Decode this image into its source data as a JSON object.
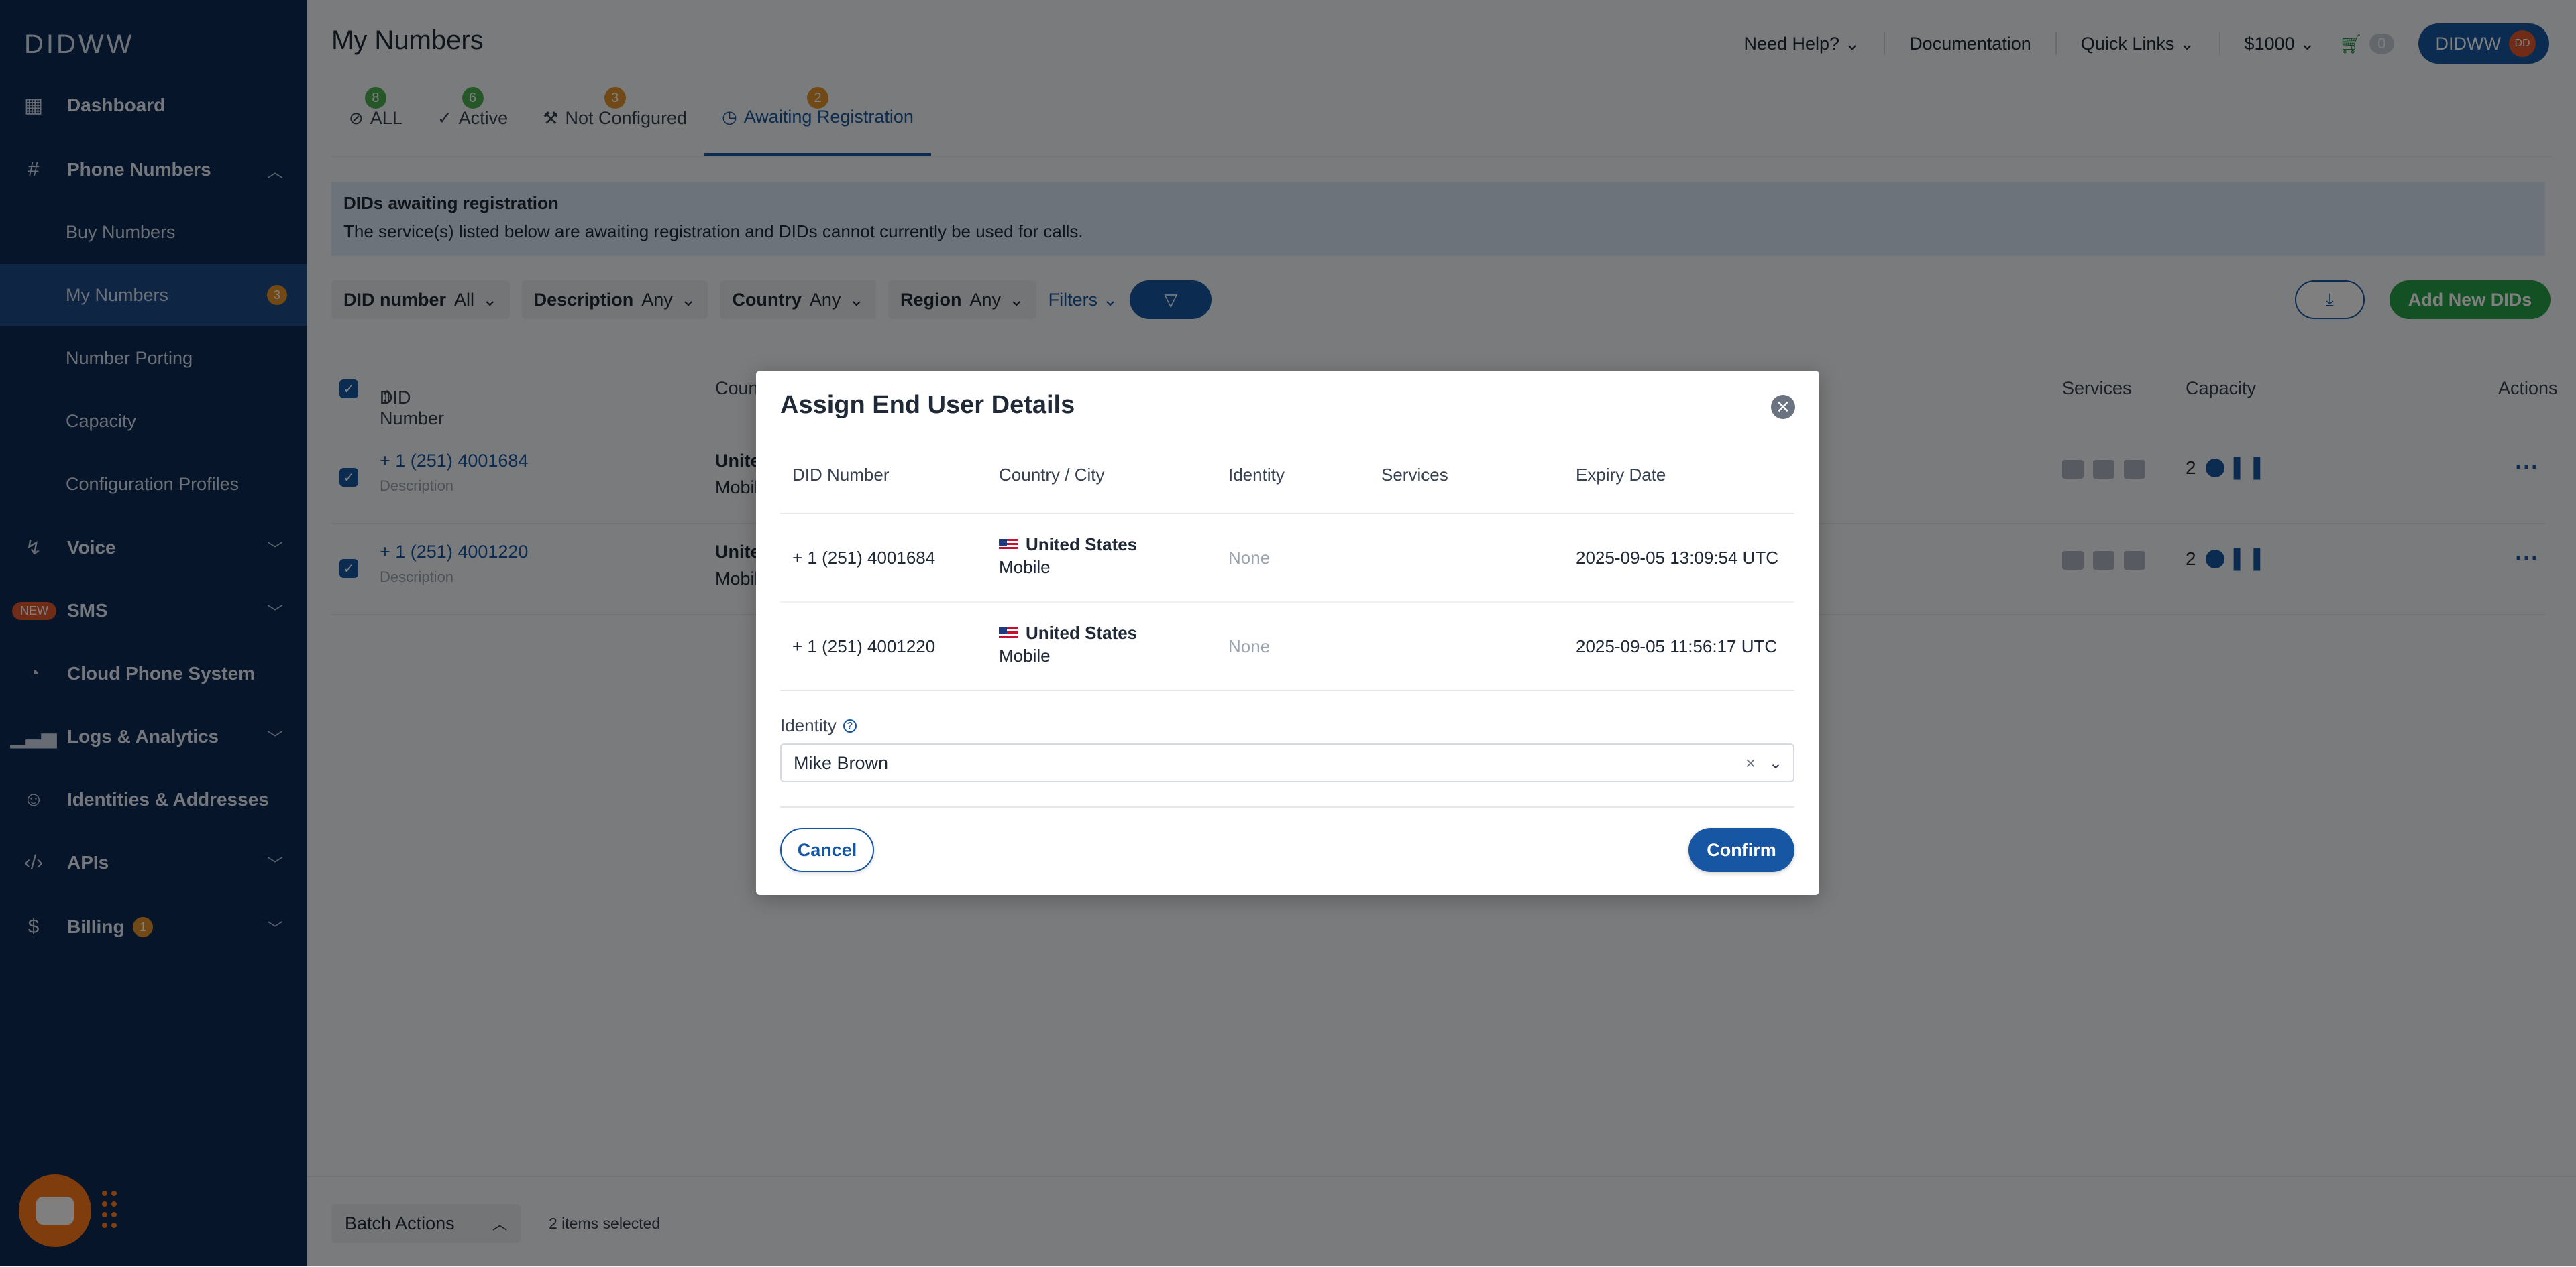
{
  "brand": {
    "logo": "DIDWW"
  },
  "sidebar": {
    "items": [
      {
        "label": "Dashboard",
        "icon": "grid-icon"
      },
      {
        "label": "Phone Numbers",
        "icon": "hash-icon",
        "expanded": true,
        "children": [
          {
            "label": "Buy Numbers"
          },
          {
            "label": "My Numbers",
            "badge": "3",
            "active": true
          },
          {
            "label": "Number Porting"
          },
          {
            "label": "Capacity"
          },
          {
            "label": "Configuration Profiles"
          }
        ]
      },
      {
        "label": "Voice",
        "icon": "voice-icon"
      },
      {
        "label": "SMS",
        "icon": "sms-icon",
        "tag": "NEW"
      },
      {
        "label": "Cloud Phone System",
        "icon": "phone-icon"
      },
      {
        "label": "Logs & Analytics",
        "icon": "chart-icon"
      },
      {
        "label": "Identities & Addresses",
        "icon": "user-icon"
      },
      {
        "label": "APIs",
        "icon": "code-icon"
      },
      {
        "label": "Billing",
        "icon": "wallet-icon",
        "badge": "1"
      }
    ]
  },
  "header": {
    "title": "My Numbers",
    "help": "Need Help?",
    "documentation": "Documentation",
    "quick_links": "Quick Links",
    "balance": "$1000",
    "cart_count": "0",
    "user_label": "DIDWW",
    "user_initials": "DD"
  },
  "tabs": [
    {
      "label": "ALL",
      "badge": "8",
      "badge_color": "#4caf50"
    },
    {
      "label": "Active",
      "badge": "6",
      "badge_color": "#4caf50"
    },
    {
      "label": "Not Configured",
      "badge": "3",
      "badge_color": "#e0922d"
    },
    {
      "label": "Awaiting Registration",
      "badge": "2",
      "badge_color": "#e0922d",
      "active": true
    }
  ],
  "alert": {
    "title": "DIDs awaiting registration",
    "text": "The service(s) listed below are awaiting registration and DIDs cannot currently be used for calls."
  },
  "filters": [
    {
      "label": "DID number",
      "value": "All"
    },
    {
      "label": "Description",
      "value": "Any"
    },
    {
      "label": "Country",
      "value": "Any"
    },
    {
      "label": "Region",
      "value": "Any"
    }
  ],
  "filters_link": "Filters",
  "add_button": "Add New DIDs",
  "table": {
    "headers": {
      "did": "DID Number",
      "country": "Country",
      "services": "Services",
      "capacity": "Capacity",
      "actions": "Actions"
    },
    "rows": [
      {
        "number": "+ 1 (251) 4001684",
        "description": "Description",
        "country": "United States",
        "type": "Mobile",
        "capacity": "2"
      },
      {
        "number": "+ 1 (251) 4001220",
        "description": "Description",
        "country": "United States",
        "type": "Mobile",
        "capacity": "2"
      }
    ]
  },
  "batch": {
    "label": "Batch Actions",
    "selected": "2 items selected"
  },
  "modal": {
    "title": "Assign End User Details",
    "headers": {
      "did": "DID Number",
      "country": "Country / City",
      "identity": "Identity",
      "services": "Services",
      "expiry": "Expiry Date"
    },
    "rows": [
      {
        "did": "+ 1 (251) 4001684",
        "country": "United States",
        "type": "Mobile",
        "identity": "None",
        "expiry": "2025-09-05 13:09:54 UTC"
      },
      {
        "did": "+ 1 (251) 4001220",
        "country": "United States",
        "type": "Mobile",
        "identity": "None",
        "expiry": "2025-09-05 11:56:17 UTC"
      }
    ],
    "identity_label": "Identity",
    "identity_value": "Mike Brown",
    "cancel": "Cancel",
    "confirm": "Confirm"
  },
  "colors": {
    "sidebar": "#0e2a56",
    "primary": "#1656a3",
    "green": "#27a046",
    "orange": "#e0922d"
  }
}
